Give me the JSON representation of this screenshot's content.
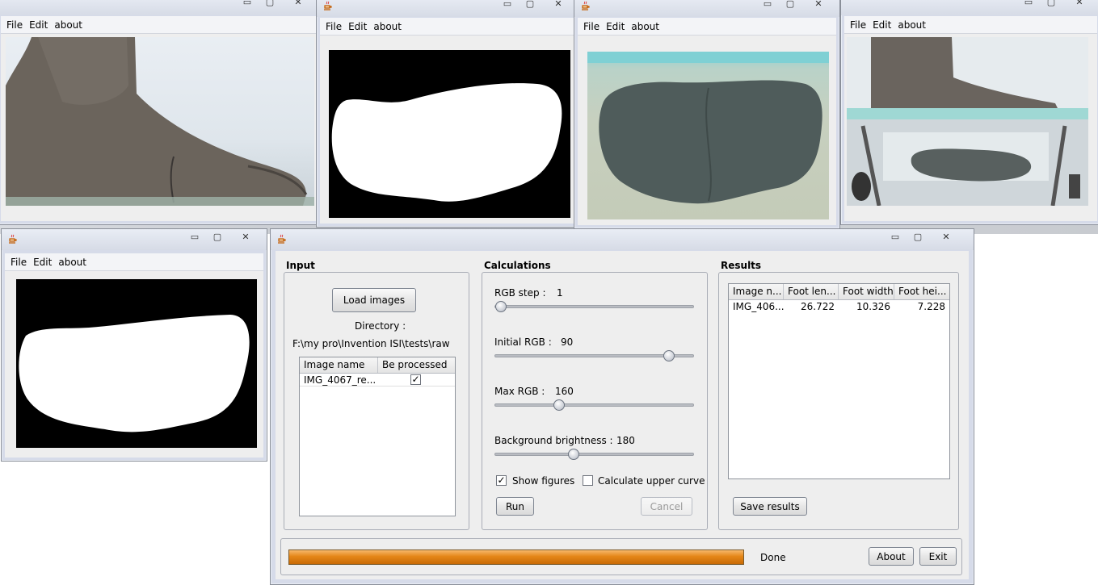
{
  "menu": [
    "File",
    "Edit",
    "about"
  ],
  "window_controls": {
    "minimize": "▭",
    "maximize": "▢",
    "close": "✕"
  },
  "windows": {
    "side_view": {
      "title": ""
    },
    "mask_top": {
      "title": ""
    },
    "sole_view": {
      "title": ""
    },
    "full_setup": {
      "title": ""
    },
    "mask_bottom": {
      "title": ""
    },
    "main": {
      "title": ""
    }
  },
  "input": {
    "title": "Input",
    "load_button": "Load images",
    "directory_label": "Directory :",
    "directory_value": "F:\\my pro\\Invention ISI\\tests\\raw",
    "columns": [
      "Image name",
      "Be processed"
    ],
    "rows": [
      {
        "name": "IMG_4067_re...",
        "processed": true,
        "check_mark": "✓"
      }
    ]
  },
  "calculations": {
    "title": "Calculations",
    "sliders": [
      {
        "label": "RGB step :",
        "value": "1",
        "min": 1,
        "max": 255,
        "position": 1
      },
      {
        "label": "Initial RGB :",
        "value": "90",
        "min": 0,
        "max": 100,
        "position": 90
      },
      {
        "label": "Max RGB :",
        "value": "160",
        "min": 0,
        "max": 100,
        "position": 31
      },
      {
        "label": "Background brightness :",
        "value": "180",
        "min": 0,
        "max": 100,
        "position": 39
      }
    ],
    "show_figures": {
      "label": "Show figures",
      "checked": true,
      "mark": "✓"
    },
    "upper_curve": {
      "label": "Calculate upper curve",
      "checked": false,
      "mark": ""
    },
    "run_button": "Run",
    "cancel_button": "Cancel"
  },
  "results": {
    "title": "Results",
    "columns": [
      "Image n...",
      "Foot len...",
      "Foot width",
      "Foot hei..."
    ],
    "rows": [
      [
        "IMG_406...",
        "26.722",
        "10.326",
        "7.228"
      ]
    ],
    "save_button": "Save results"
  },
  "status": {
    "progress_fraction": 1.0,
    "text": "Done",
    "about_button": "About",
    "exit_button": "Exit"
  },
  "colors": {
    "progress": "#e48617",
    "window_frame": "#d6dbe9",
    "panel": "#eeeeee"
  }
}
